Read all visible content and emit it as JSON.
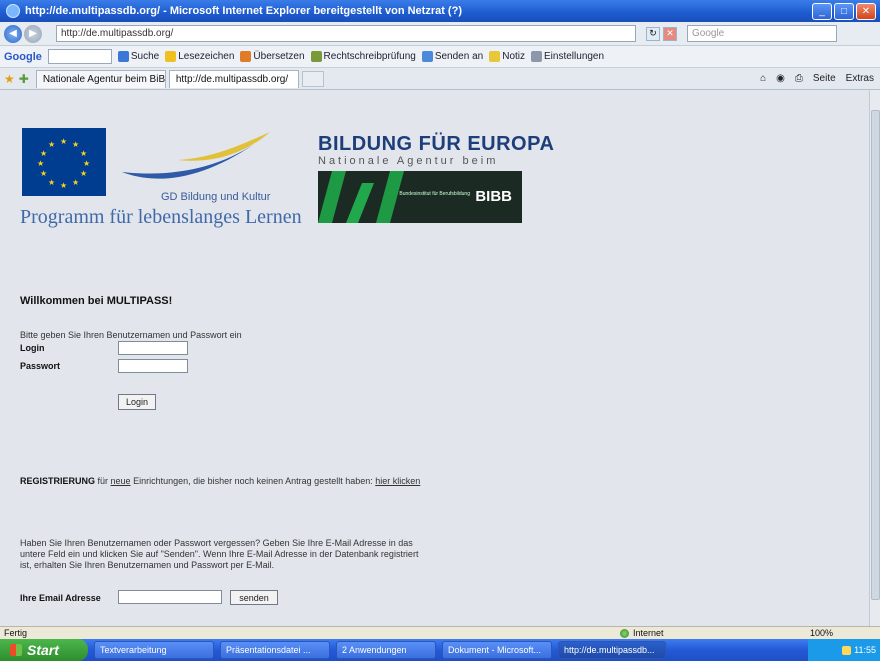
{
  "window": {
    "title": "http://de.multipassdb.org/ - Microsoft Internet Explorer bereitgestellt von Netzrat (?)"
  },
  "address_bar": {
    "url": "http://de.multipassdb.org/",
    "search_placeholder": "Google"
  },
  "google_toolbar": {
    "logo": "Google",
    "items": [
      "Suche",
      "Lesezeichen",
      "Übersetzen",
      "Rechtschreibprüfung",
      "Senden an",
      "Notiz",
      "Einstellungen"
    ]
  },
  "tabs": [
    {
      "label": "Nationale Agentur beim BiBB",
      "active": false
    },
    {
      "label": "http://de.multipassdb.org/",
      "active": true
    }
  ],
  "command_bar": [
    "Seite",
    "Extras"
  ],
  "header": {
    "gd_text": "GD Bildung und Kultur",
    "programm": "Programm für lebenslanges Lernen",
    "bfe_title": "BILDUNG FÜR EUROPA",
    "bfe_sub": "Nationale Agentur beim",
    "bibb_small": "Bundesinstitut für Berufsbildung",
    "bibb_logo": "BIBB"
  },
  "login": {
    "welcome": "Willkommen bei MULTIPASS!",
    "hint": "Bitte geben Sie Ihren Benutzernamen und Passwort ein",
    "login_label": "Login",
    "password_label": "Passwort",
    "login_button": "Login"
  },
  "registration": {
    "bold": "REGISTRIERUNG",
    "text1": " für ",
    "link_neue": "neue",
    "text2": " Einrichtungen, die bisher noch keinen Antrag gestellt haben: ",
    "link_hier": "hier klicken"
  },
  "forgot": {
    "text": "Haben Sie Ihren Benutzernamen oder Passwort vergessen? Geben Sie Ihre E-Mail Adresse in das untere Feld ein und klicken Sie auf \"Senden\". Wenn Ihre E-Mail Adresse in der Datenbank registriert ist, erhalten Sie Ihren Benutzernamen und Passwort per E-Mail.",
    "email_label": "Ihre Email Adresse",
    "send_button": "senden"
  },
  "status_bar": {
    "left": "Fertig",
    "zone": "Internet",
    "zoom": "100%"
  },
  "taskbar": {
    "start": "Start",
    "items": [
      "Textverarbeitung",
      "Präsentationsdatei ...",
      "2 Anwendungen",
      "Dokument - Microsoft...",
      "http://de.multipassdb..."
    ],
    "clock": "11:55"
  }
}
